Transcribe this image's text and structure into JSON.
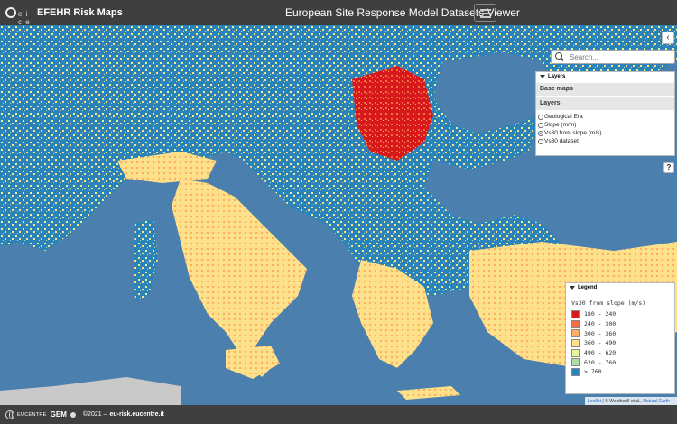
{
  "header": {
    "brand_logo_text": "e i c e",
    "brand_name": "EFEHR Risk Maps",
    "title": "European Site Response Model Datasets Viewer"
  },
  "search": {
    "placeholder": "Search..."
  },
  "layers_panel": {
    "heading": "Layers",
    "base_maps_label": "Base maps",
    "layers_label": "Layers",
    "options": [
      {
        "label": "Geological Era",
        "selected": false
      },
      {
        "label": "Slope (m/m)",
        "selected": false
      },
      {
        "label": "Vs30 from slope (m/s)",
        "selected": true
      },
      {
        "label": "Vs30 dataset",
        "selected": false
      }
    ]
  },
  "help_label": "?",
  "collapse_label": "‹",
  "legend": {
    "heading": "Legend",
    "title": "Vs30 from slope (m/s)",
    "items": [
      {
        "label": "180 - 240",
        "color": "#d7191c"
      },
      {
        "label": "240 - 300",
        "color": "#f46d43"
      },
      {
        "label": "300 - 360",
        "color": "#fdae61"
      },
      {
        "label": "360 - 490",
        "color": "#fee08b"
      },
      {
        "label": "490 - 620",
        "color": "#e6f598"
      },
      {
        "label": "620 - 760",
        "color": "#abdda4"
      },
      {
        "label": "> 760",
        "color": "#2b83ba"
      }
    ]
  },
  "attribution": {
    "leaflet": "Leaflet",
    "rest": " | © Weatherill et al., ",
    "natural_earth": "Natural Earth"
  },
  "footer": {
    "eucentre": "EUCENTRE",
    "gem": "GEM",
    "copyright": "©2021 –",
    "link": "eu-risk.eucentre.it"
  },
  "colors": {
    "topbar": "#3f3f3f",
    "sea": "#4a7fae",
    "land_default": "#2b83ba"
  }
}
